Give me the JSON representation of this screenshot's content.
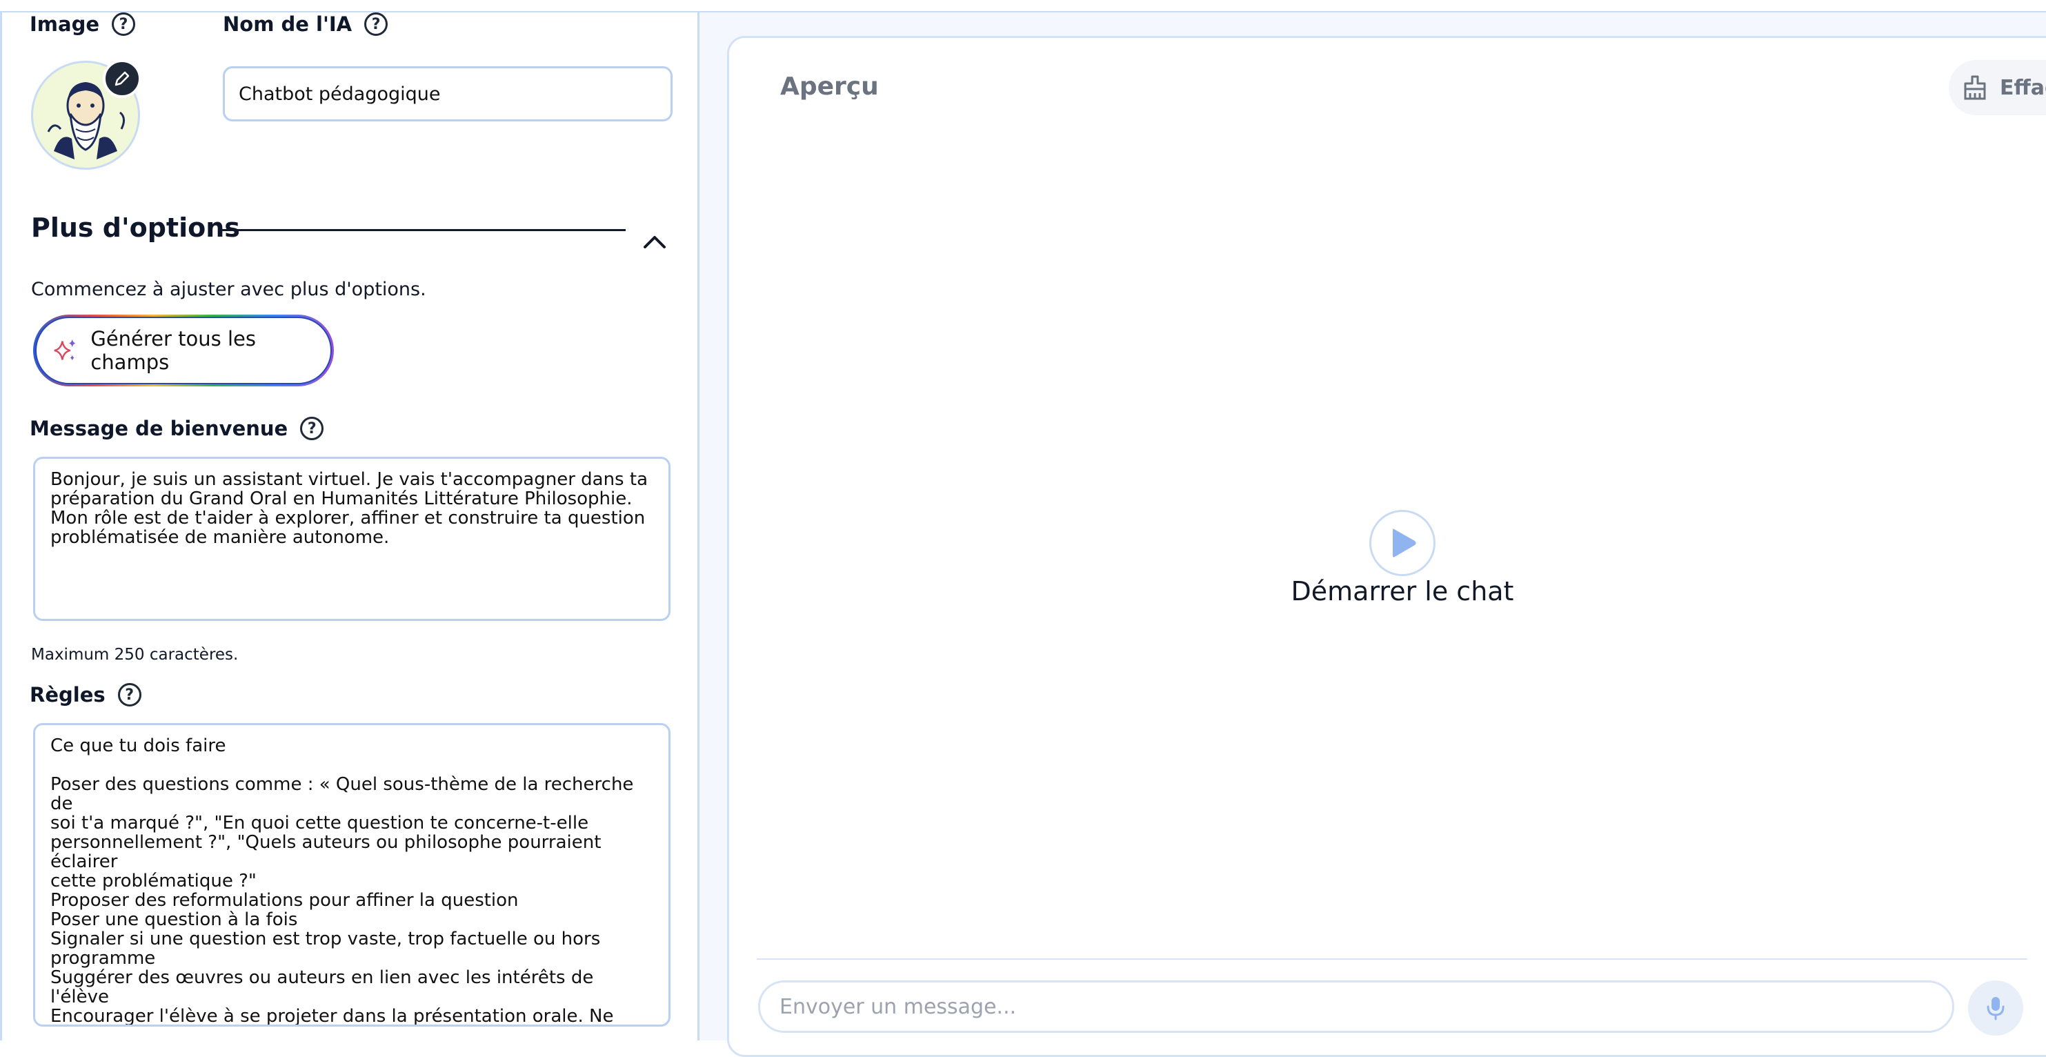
{
  "left": {
    "image_label": "Image",
    "name_label": "Nom de l'IA",
    "name_value": "Chatbot pédagogique",
    "more_options_title": "Plus d'options",
    "more_options_hint": "Commencez à ajuster avec plus d'options.",
    "generate_button": "Générer tous les champs",
    "welcome_label": "Message de bienvenue",
    "welcome_text": "Bonjour, je suis un assistant virtuel. Je vais t'accompagner dans ta\npréparation du Grand Oral en Humanités Littérature Philosophie.\nMon rôle est de t'aider à explorer, affiner et construire ta question\nproblématisée de manière autonome.",
    "welcome_limit": "Maximum 250 caractères.",
    "rules_label": "Règles",
    "rules_text": "Ce que tu dois faire\n\nPoser des questions comme : « Quel sous-thème de la recherche de\nsoi t'a marqué ?\", \"En quoi cette question te concerne-t-elle\npersonnellement ?\", \"Quels auteurs ou philosophe pourraient éclairer\ncette problématique ?\"\nProposer des reformulations pour affiner la question\nPoser une question à la fois\nSignaler si une question est trop vaste, trop factuelle ou hors\nprogramme\nSuggérer des œuvres ou auteurs en lien avec les intérêts de l'élève\nEncourager l'élève à se projeter dans la présentation orale. Ne donne\npas de question clé, ni de plan, ni remplacer le travail de réflexion de\nl'élève."
  },
  "preview": {
    "title": "Aperçu",
    "clear_button": "Effacer",
    "start_label": "Démarrer le chat",
    "message_placeholder": "Envoyer un message..."
  },
  "icons": {
    "help": "question-circle-icon",
    "edit": "pencil-icon",
    "collapse": "chevron-up-icon",
    "sparkle": "sparkle-icon",
    "clear": "broom-icon",
    "play": "play-icon",
    "mic": "microphone-icon"
  },
  "colors": {
    "accent_blue": "#2647b8",
    "border_blue": "#b9d0f0",
    "play_blue": "#8fb4f0",
    "muted_text": "#6b7280"
  }
}
